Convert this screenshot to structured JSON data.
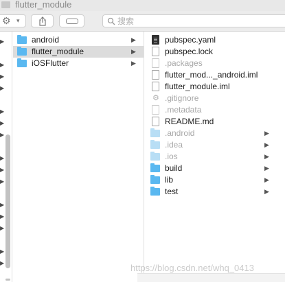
{
  "window": {
    "title": "flutter_module"
  },
  "toolbar": {
    "action_icon": "gear-icon",
    "share_icon": "share-icon",
    "tag_icon": "tag-icon",
    "search_placeholder": "搜索"
  },
  "middle_column": {
    "items": [
      {
        "name": "android",
        "type": "folder",
        "selected": false
      },
      {
        "name": "flutter_module",
        "type": "folder",
        "selected": true
      },
      {
        "name": "iOSFlutter",
        "type": "folder",
        "selected": false
      }
    ]
  },
  "right_column": {
    "items": [
      {
        "name": "pubspec.yaml",
        "type": "yaml-file",
        "hidden": false
      },
      {
        "name": "pubspec.lock",
        "type": "file",
        "hidden": false
      },
      {
        "name": ".packages",
        "type": "file",
        "hidden": true
      },
      {
        "name": "flutter_mod..._android.iml",
        "type": "file",
        "hidden": false
      },
      {
        "name": "flutter_module.iml",
        "type": "file",
        "hidden": false
      },
      {
        "name": ".gitignore",
        "type": "gear-file",
        "hidden": true
      },
      {
        "name": ".metadata",
        "type": "file",
        "hidden": true
      },
      {
        "name": "README.md",
        "type": "file",
        "hidden": false
      },
      {
        "name": ".android",
        "type": "folder",
        "hidden": true
      },
      {
        "name": ".idea",
        "type": "folder",
        "hidden": true
      },
      {
        "name": ".ios",
        "type": "folder",
        "hidden": true
      },
      {
        "name": "build",
        "type": "folder",
        "hidden": false
      },
      {
        "name": "lib",
        "type": "folder",
        "hidden": false
      },
      {
        "name": "test",
        "type": "folder",
        "hidden": false
      }
    ]
  },
  "watermark": "https://blog.csdn.net/whq_0413"
}
